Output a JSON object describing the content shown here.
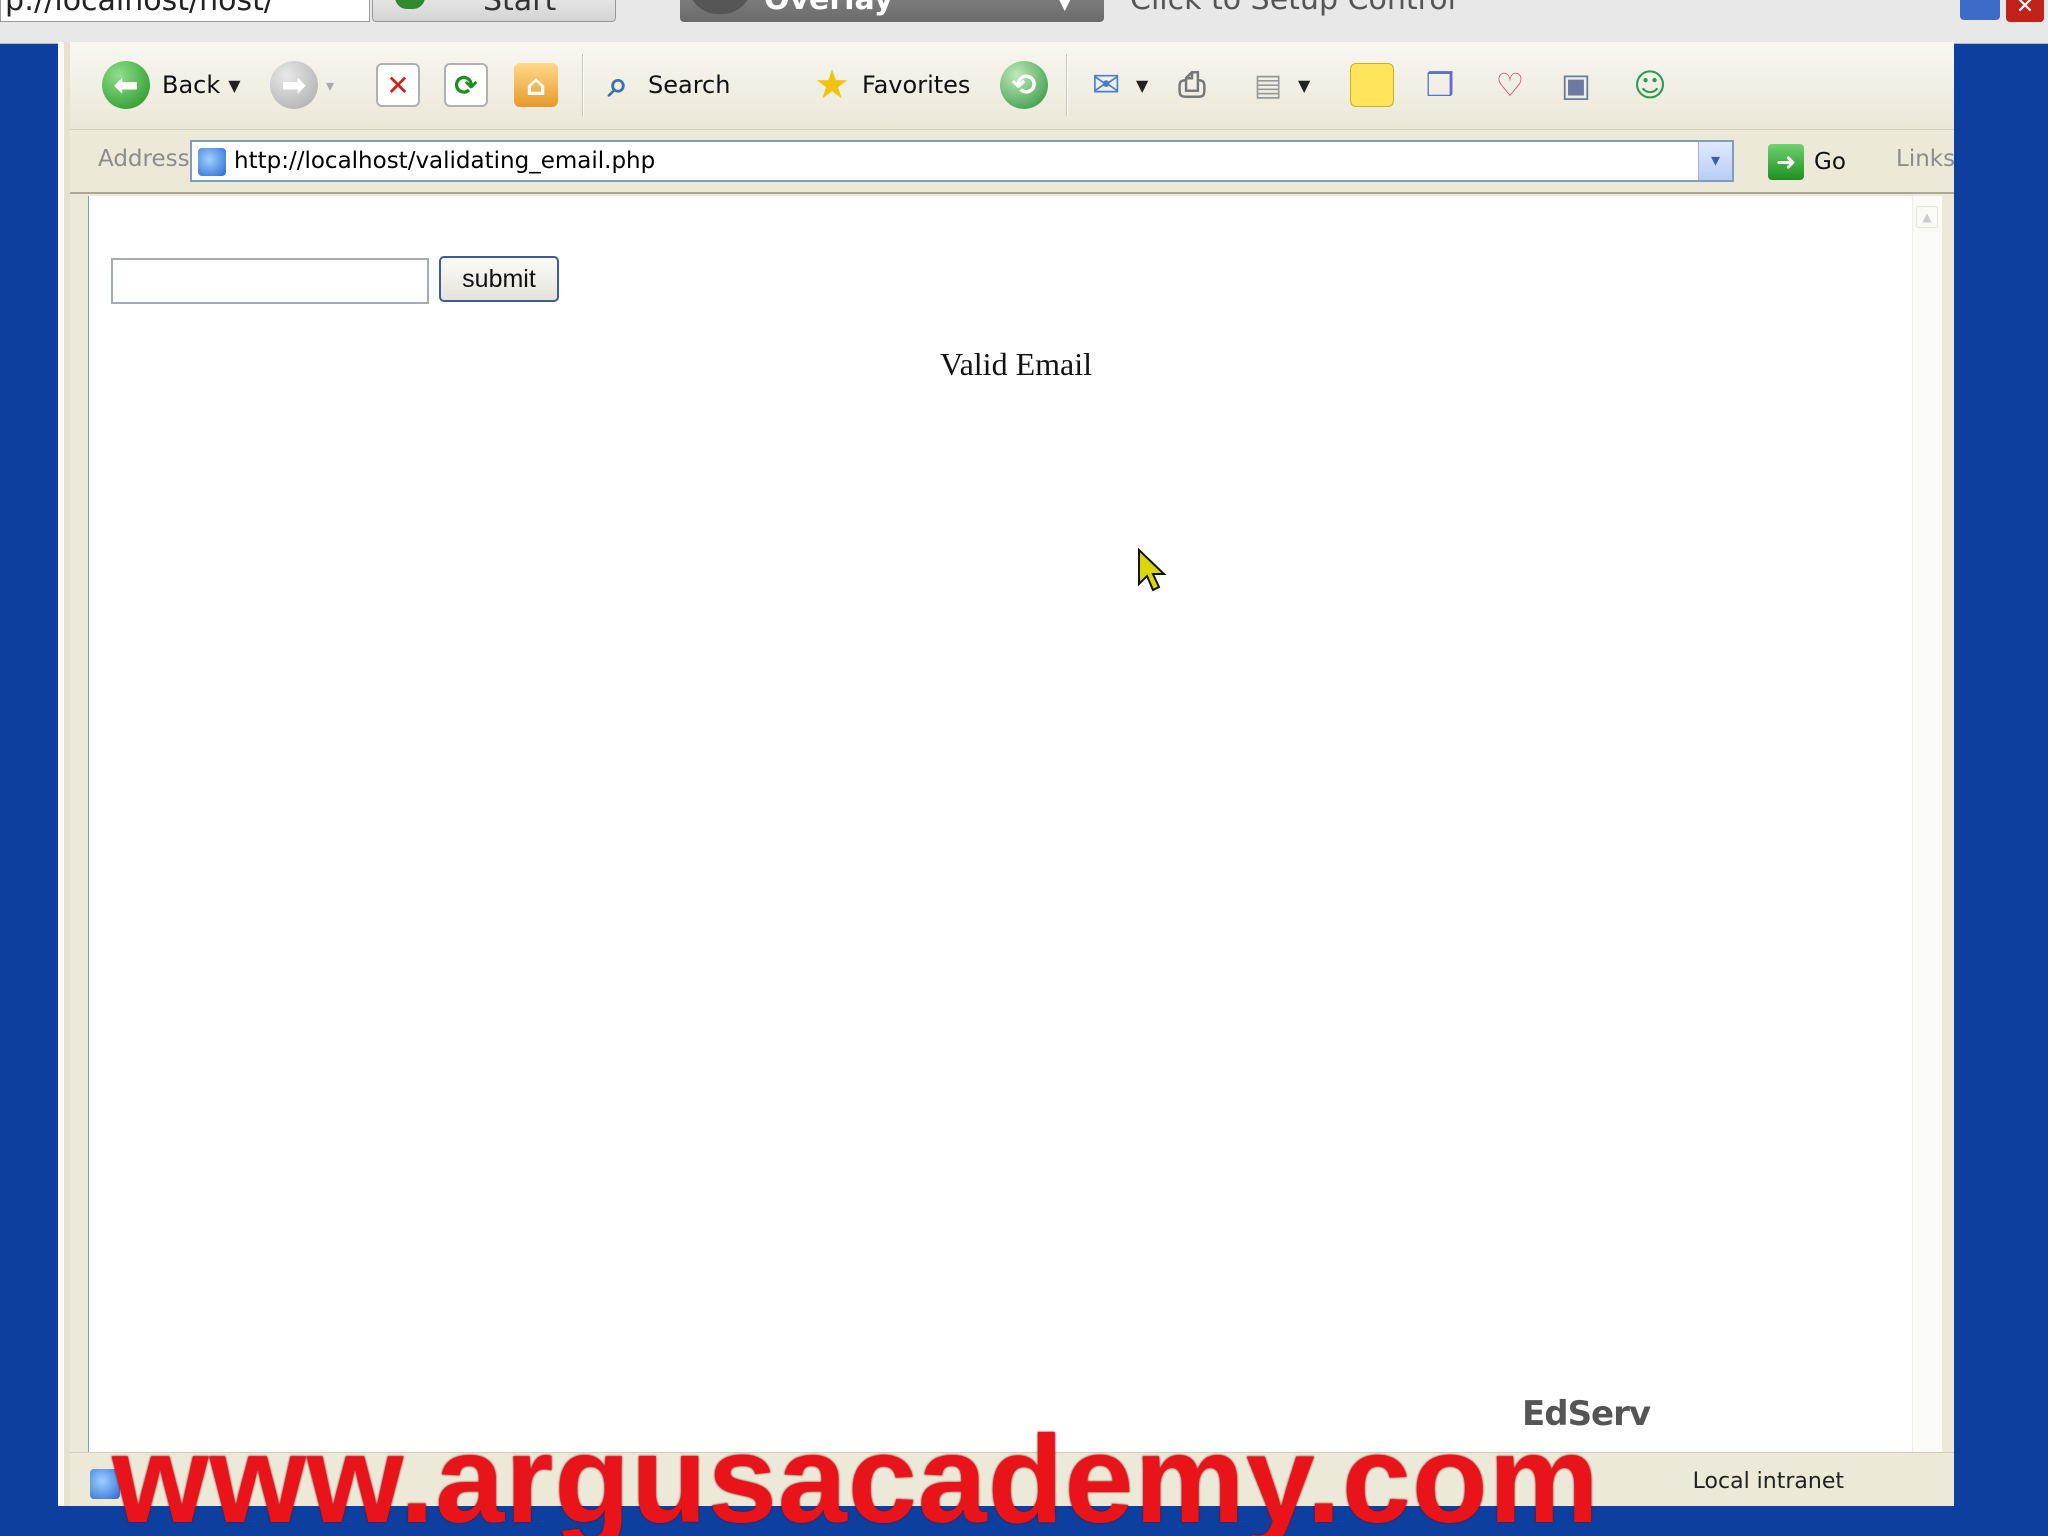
{
  "recorder": {
    "url_fragment": "p://localhost/host/",
    "btn1_label": "Start",
    "btn2_label": "Overlay",
    "setup_label": "Click to Setup Control"
  },
  "toolbar": {
    "back_label": "Back",
    "search_label": "Search",
    "favorites_label": "Favorites"
  },
  "address": {
    "label": "Address",
    "url": "http://localhost/validating_email.php",
    "go_label": "Go",
    "links_label": "Links"
  },
  "page": {
    "input_value": "",
    "submit_label": "submit",
    "result_text": "Valid Email"
  },
  "statusbar": {
    "zone": "Local intranet"
  },
  "overlay": {
    "brand": "EdServ",
    "watermark": "www.argusacademy.com"
  },
  "colors": {
    "desktop": "#0d3fa0",
    "watermark": "#e8141a",
    "window": "#ece9d8"
  }
}
